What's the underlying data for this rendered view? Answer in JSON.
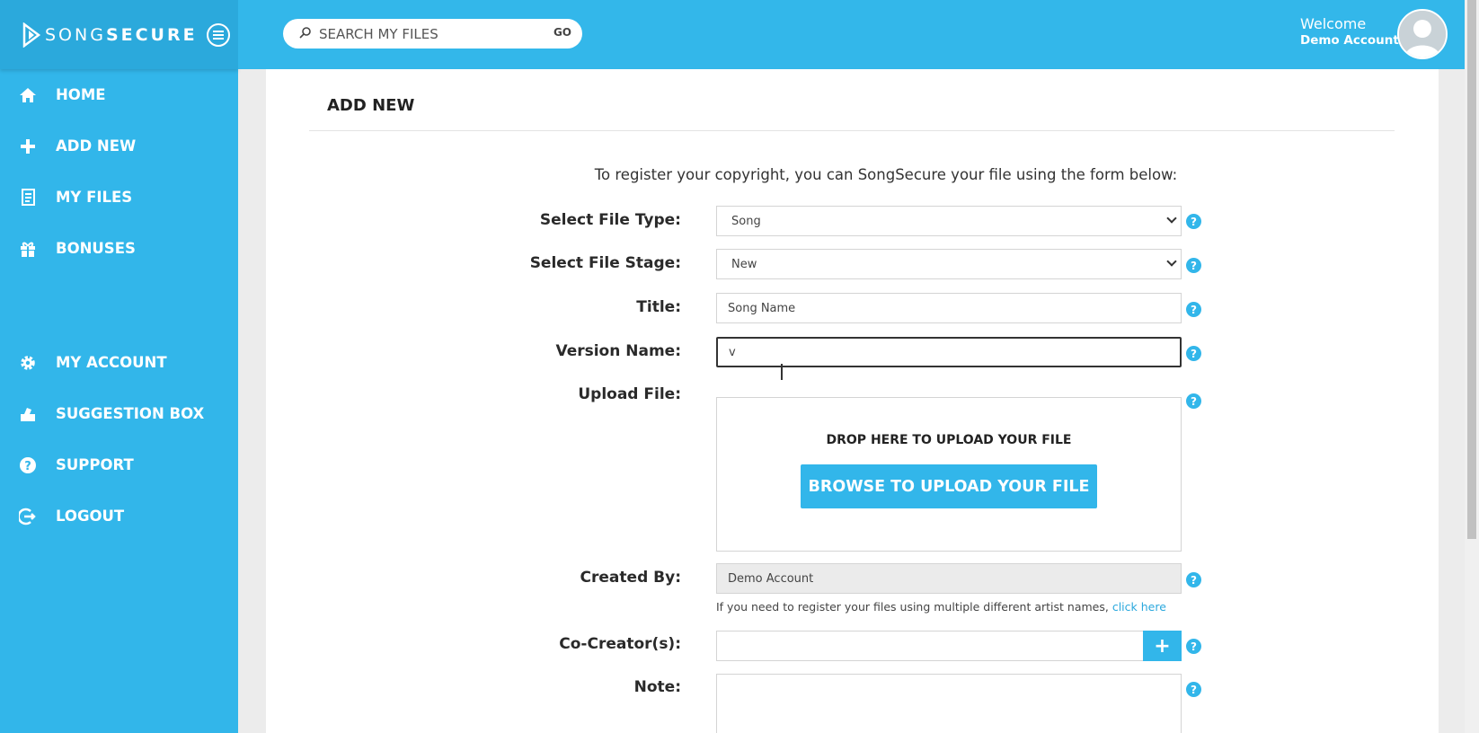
{
  "brand": {
    "name_light": "SONG",
    "name_bold": "SECURE"
  },
  "sidebar": {
    "items": [
      {
        "label": "HOME",
        "icon": "home-icon"
      },
      {
        "label": "ADD NEW",
        "icon": "plus-icon"
      },
      {
        "label": "MY FILES",
        "icon": "files-icon"
      },
      {
        "label": "BONUSES",
        "icon": "gift-icon"
      },
      {
        "label": "MY ACCOUNT",
        "icon": "gear-icon"
      },
      {
        "label": "SUGGESTION BOX",
        "icon": "suggestion-box-icon"
      },
      {
        "label": "SUPPORT",
        "icon": "question-icon"
      },
      {
        "label": "LOGOUT",
        "icon": "logout-icon"
      }
    ]
  },
  "header": {
    "search_placeholder": "SEARCH MY FILES",
    "search_go": "GO",
    "welcome_label": "Welcome",
    "welcome_name": "Demo Account"
  },
  "page": {
    "title": "ADD NEW",
    "intro": "To register your copyright, you can SongSecure your file using the form below:"
  },
  "form": {
    "file_type": {
      "label": "Select File Type:",
      "value": "Song"
    },
    "file_stage": {
      "label": "Select File Stage:",
      "value": "New"
    },
    "title": {
      "label": "Title:",
      "value": "Song Name"
    },
    "version_name": {
      "label": "Version Name:",
      "value": "v"
    },
    "upload": {
      "label": "Upload File:",
      "drop_text": "DROP HERE TO UPLOAD YOUR FILE",
      "browse_label": "BROWSE TO UPLOAD YOUR FILE"
    },
    "created_by": {
      "label": "Created By:",
      "value": "Demo Account",
      "hint": "If you need to register your files using multiple different artist names,",
      "hint_link": "click here"
    },
    "co_creators": {
      "label": "Co-Creator(s):",
      "add_label": "+"
    },
    "note": {
      "label": "Note:"
    },
    "help_glyph": "?"
  },
  "colors": {
    "accent": "#32b6ea",
    "sidebar_bg": "#32b6ea",
    "link": "#2aa8dd"
  }
}
